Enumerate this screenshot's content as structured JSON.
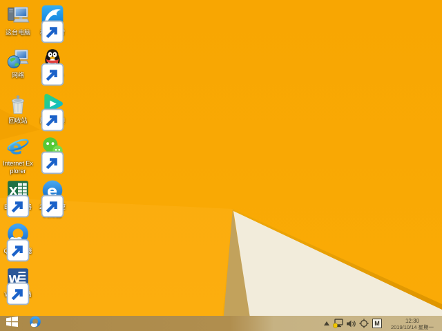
{
  "desktop": {
    "icons": [
      {
        "label": "这台电脑",
        "name": "this-pc",
        "shortcut": false
      },
      {
        "label": "极速迅雷",
        "name": "xunlei",
        "shortcut": true
      },
      {
        "label": "网络",
        "name": "network",
        "shortcut": false
      },
      {
        "label": "腾讯QQ",
        "name": "tencent-qq",
        "shortcut": true
      },
      {
        "label": "回收站",
        "name": "recycle-bin",
        "shortcut": false
      },
      {
        "label": "腾讯视频",
        "name": "tencent-video",
        "shortcut": true
      },
      {
        "label": "Internet Explorer",
        "name": "internet-explorer",
        "shortcut": false
      },
      {
        "label": "微信",
        "name": "wechat",
        "shortcut": true
      },
      {
        "label": "Excel表格",
        "name": "excel",
        "shortcut": true
      },
      {
        "label": "2345加速浏览器",
        "name": "2345-browser",
        "shortcut": true
      },
      {
        "label": "QQ浏览器",
        "name": "qq-browser",
        "shortcut": true
      },
      {
        "label": "Word文档",
        "name": "word",
        "shortcut": true
      }
    ]
  },
  "taskbar": {
    "start_tooltip": "开始",
    "pinned": [
      {
        "name": "qq-browser"
      }
    ],
    "tray": {
      "hidden_icons": "show-hidden-icons",
      "icons": [
        "network-alert",
        "volume",
        "safety-crosshair",
        "ime"
      ],
      "ime_label": "M"
    },
    "clock": {
      "time": "12:30",
      "date": "2019/10/14 星期一"
    }
  },
  "colors": {
    "wallpaper_orange": "#f9a702",
    "wallpaper_bright_wedge": "#fbae10",
    "wallpaper_cream": "#f2ecdb",
    "wallpaper_tan": "#c2a25c",
    "wallpaper_ridge": "#e89e02",
    "taskbar_left": "#ab894a",
    "taskbar_right": "#cab78a"
  }
}
